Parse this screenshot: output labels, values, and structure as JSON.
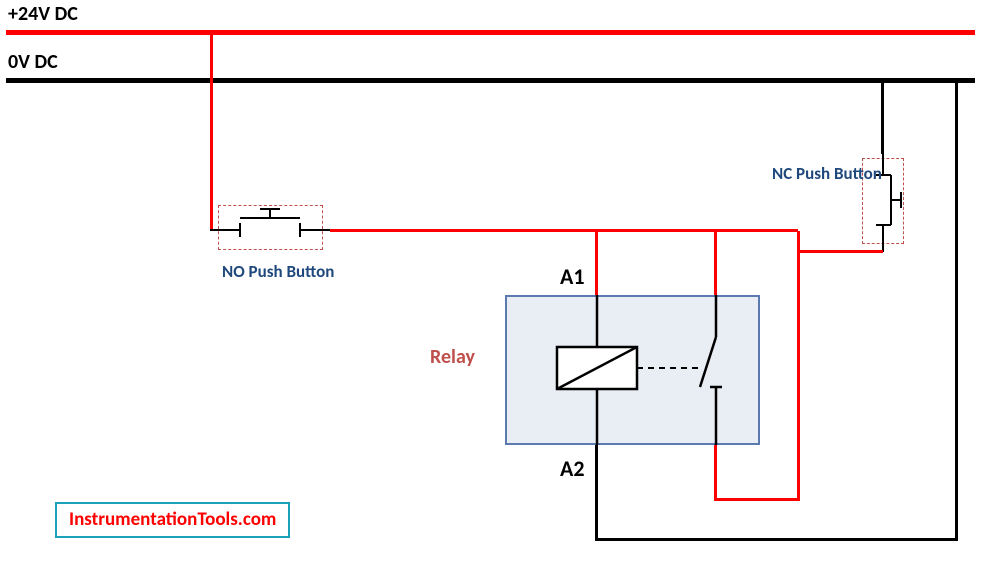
{
  "labels": {
    "positive_rail": "+24V DC",
    "negative_rail": "0V DC",
    "no_button": "NO Push Button",
    "nc_button": "NC Push Button",
    "relay": "Relay",
    "coil_a1": "A1",
    "coil_a2": "A2"
  },
  "watermark": "InstrumentationTools.com",
  "colors": {
    "positive": "#ff0000",
    "negative": "#000000",
    "label": "#1f497d",
    "relay_label": "#c0504d",
    "relay_box_border": "#5b7ab0",
    "relay_box_fill": "#e9edf4",
    "watermark_border": "#1aa3b8",
    "watermark_text": "#ff0000"
  }
}
